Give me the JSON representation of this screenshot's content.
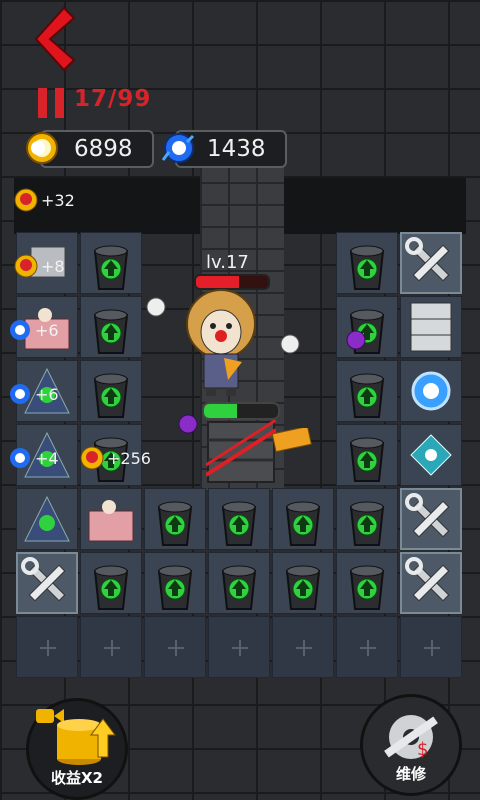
{
  "hud": {
    "wave_progress": "17/99",
    "coins": "6898",
    "gems": "1438"
  },
  "bonuses": [
    {
      "text": "+32"
    },
    {
      "text": "+8"
    },
    {
      "text": "+6"
    },
    {
      "text": "+6"
    },
    {
      "text": "+4"
    },
    {
      "text": "+256"
    }
  ],
  "monster": {
    "level_label": "lv.17",
    "hp_fraction": 0.6,
    "door_hp_fraction": 0.45
  },
  "buttons": {
    "income_label": "收益X2",
    "repair_label": "维修"
  },
  "colors": {
    "accent_red": "#d8232a",
    "arrow_green": "#2fd13f",
    "coin_gold": "#f0b400",
    "gem_blue": "#1f6cf2"
  }
}
